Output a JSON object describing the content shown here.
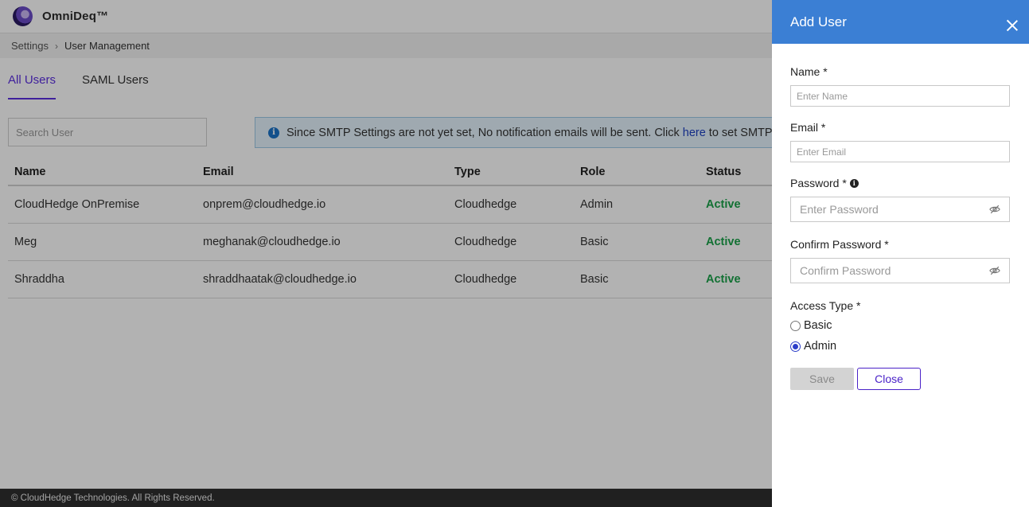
{
  "app": {
    "brand": "OmniDeq™"
  },
  "breadcrumb": {
    "parent": "Settings",
    "current": "User Management"
  },
  "tabs": [
    {
      "label": "All Users"
    },
    {
      "label": "SAML Users"
    }
  ],
  "search": {
    "placeholder": "Search User"
  },
  "banner": {
    "text_before": "Since SMTP Settings are not yet set, No notification emails will be sent. Click",
    "link": "here",
    "text_after": "to set SMTP s"
  },
  "table": {
    "headers": [
      "Name",
      "Email",
      "Type",
      "Role",
      "Status"
    ],
    "rows": [
      {
        "name": "CloudHedge OnPremise",
        "email": "onprem@cloudhedge.io",
        "type": "Cloudhedge",
        "role": "Admin",
        "status": "Active"
      },
      {
        "name": "Meg",
        "email": "meghanak@cloudhedge.io",
        "type": "Cloudhedge",
        "role": "Basic",
        "status": "Active"
      },
      {
        "name": "Shraddha",
        "email": "shraddhaatak@cloudhedge.io",
        "type": "Cloudhedge",
        "role": "Basic",
        "status": "Active"
      }
    ]
  },
  "footer": {
    "text": "© CloudHedge Technologies. All Rights Reserved."
  },
  "panel": {
    "title": "Add User",
    "name_label": "Name *",
    "name_placeholder": "Enter Name",
    "email_label": "Email *",
    "email_placeholder": "Enter Email",
    "password_label": "Password *",
    "password_placeholder": "Enter Password",
    "confirm_label": "Confirm Password *",
    "confirm_placeholder": "Confirm Password",
    "access_label": "Access Type *",
    "access_options": [
      {
        "label": "Basic",
        "checked": false
      },
      {
        "label": "Admin",
        "checked": true
      }
    ],
    "save_label": "Save",
    "close_label": "Close"
  },
  "colors": {
    "accent": "#5b2ee0",
    "header": "#3b7fd4",
    "active": "#1aa24a"
  }
}
